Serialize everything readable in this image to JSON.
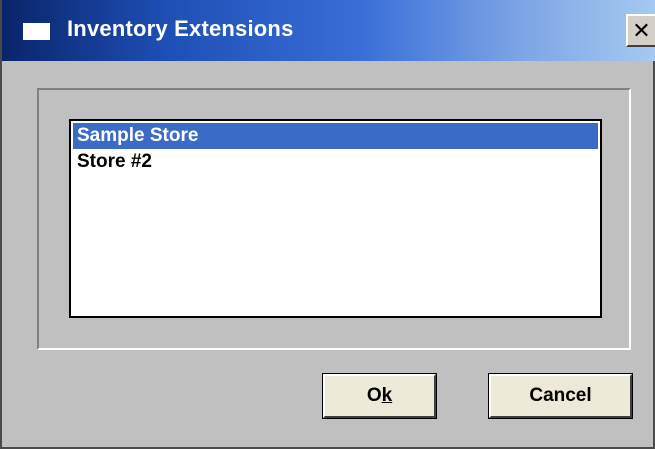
{
  "window": {
    "title": "Inventory Extensions",
    "close_glyph": "✕"
  },
  "stores": {
    "items": [
      {
        "label": "Sample Store",
        "selected": true
      },
      {
        "label": "Store #2",
        "selected": false
      }
    ]
  },
  "buttons": {
    "ok_prefix": "O",
    "ok_underlined": "k",
    "cancel": "Cancel"
  },
  "colors": {
    "selection": "#3c6bc5",
    "titlebar_start": "#0a246a",
    "titlebar_end": "#a6caf0"
  }
}
